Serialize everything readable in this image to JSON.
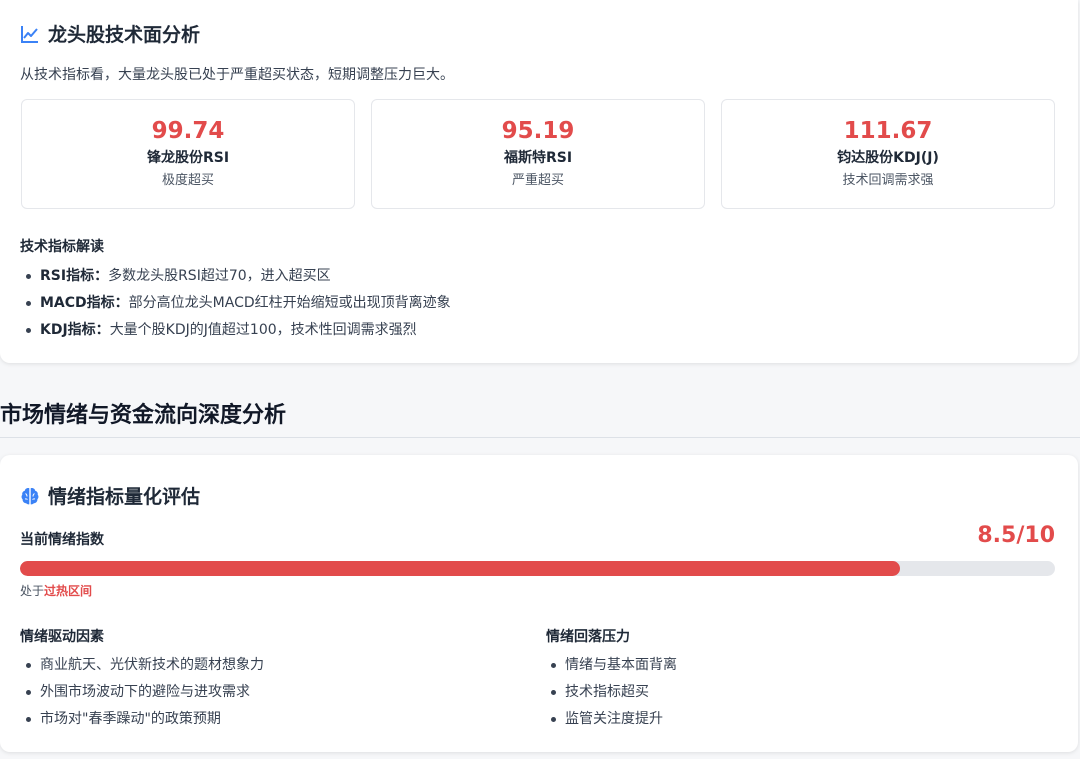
{
  "tech": {
    "title": "龙头股技术面分析",
    "intro": "从技术指标看，大量龙头股已处于严重超买状态，短期调整压力巨大。",
    "stats": [
      {
        "value": "99.74",
        "name": "锋龙股份RSI",
        "desc": "极度超买"
      },
      {
        "value": "95.19",
        "name": "福斯特RSI",
        "desc": "严重超买"
      },
      {
        "value": "111.67",
        "name": "钧达股份KDJ(J)",
        "desc": "技术回调需求强"
      }
    ],
    "reading_title": "技术指标解读",
    "readings": [
      {
        "label": "RSI指标：",
        "text": "多数龙头股RSI超过70，进入超买区"
      },
      {
        "label": "MACD指标：",
        "text": "部分高位龙头MACD红柱开始缩短或出现顶背离迹象"
      },
      {
        "label": "KDJ指标：",
        "text": "大量个股KDJ的J值超过100，技术性回调需求强烈"
      }
    ]
  },
  "section": {
    "title": "市场情绪与资金流向深度分析"
  },
  "sentiment": {
    "title": "情绪指标量化评估",
    "index_label": "当前情绪指数",
    "index_value": "8.5/10",
    "index_fraction": 0.85,
    "status_prefix": "处于",
    "status_hot": "过热区间",
    "drivers_title": "情绪驱动因素",
    "drivers": [
      "商业航天、光伏新技术的题材想象力",
      "外围市场波动下的避险与进攻需求",
      "市场对\"春季躁动\"的政策预期"
    ],
    "pressure_title": "情绪回落压力",
    "pressures": [
      "情绪与基本面背离",
      "技术指标超买",
      "监管关注度提升"
    ]
  },
  "colors": {
    "accent_red": "#e24b4b",
    "icon_blue": "#3b82f6"
  },
  "icons": {
    "tech": "chart-line-icon",
    "sentiment": "brain-icon"
  }
}
